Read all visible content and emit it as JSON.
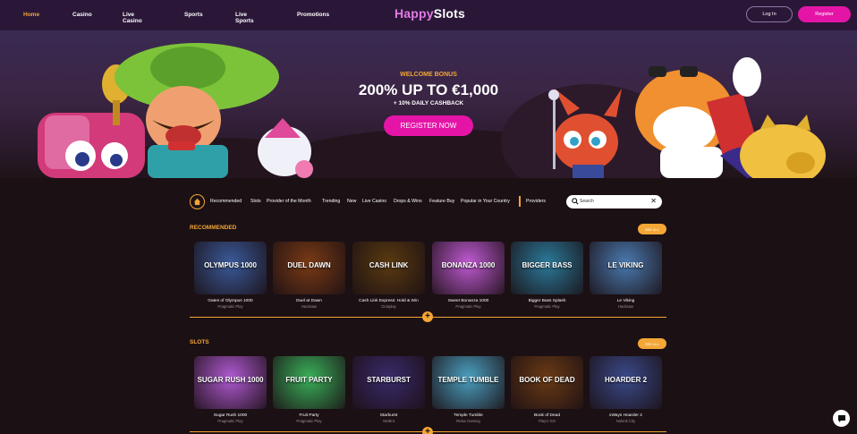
{
  "nav": {
    "links": [
      "Home",
      "Casino",
      "Live Casino",
      "Sports",
      "Live Sports",
      "Promotions"
    ],
    "logo_part1": "Happy",
    "logo_part2": "Slots",
    "login_label": "Log In",
    "register_label": "Register"
  },
  "hero": {
    "bonus_label": "WELCOME BONUS",
    "title": "200% UP TO €1,000",
    "subtitle": "+ 10% DAILY CASHBACK",
    "cta_label": "REGISTER NOW"
  },
  "filters": {
    "items": [
      "Recommended",
      "Slots",
      "Provider of the Month",
      "Trending",
      "New",
      "Live Casino",
      "Drops & Wins",
      "Feature Buy",
      "Popular in Your Country",
      "Providers"
    ]
  },
  "search": {
    "placeholder": "Search"
  },
  "sections": [
    {
      "title": "RECOMMENDED",
      "see_all": "SEE ALL",
      "games": [
        {
          "name": "Gates of Olympus 1000",
          "provider": "Pragmatic Play",
          "art": "OLYMPUS 1000",
          "color": "#3a5a9a"
        },
        {
          "name": "Duel at Dawn",
          "provider": "Hacksaw",
          "art": "DUEL DAWN",
          "color": "#7a3a14"
        },
        {
          "name": "Cash Link Express: Hold & Win",
          "provider": "Octoplay",
          "art": "CASH LINK",
          "color": "#5a3a10"
        },
        {
          "name": "Sweet Bonanza 1000",
          "provider": "Pragmatic Play",
          "art": "BONANZA 1000",
          "color": "#c05ad2"
        },
        {
          "name": "Bigger Bass Splash",
          "provider": "Pragmatic Play",
          "art": "BIGGER BASS",
          "color": "#2a7a9a"
        },
        {
          "name": "Le Viking",
          "provider": "Hacksaw",
          "art": "LE VIKING",
          "color": "#4a7ab0"
        }
      ]
    },
    {
      "title": "SLOTS",
      "see_all": "SEE ALL",
      "games": [
        {
          "name": "Sugar Rush 1000",
          "provider": "Pragmatic Play",
          "art": "SUGAR RUSH 1000",
          "color": "#b05ad2"
        },
        {
          "name": "Fruit Party",
          "provider": "Pragmatic Play",
          "art": "FRUIT PARTY",
          "color": "#3ab05a"
        },
        {
          "name": "Starburst",
          "provider": "NetEnt",
          "art": "STARBURST",
          "color": "#3a2a6a"
        },
        {
          "name": "Temple Tumble",
          "provider": "Relax Gaming",
          "art": "TEMPLE TUMBLE",
          "color": "#4aa0c0"
        },
        {
          "name": "Book of Dead",
          "provider": "Play'n GO",
          "art": "BOOK OF DEAD",
          "color": "#6a3a14"
        },
        {
          "name": "xWays Hoarder 2",
          "provider": "Nolimit City",
          "art": "HOARDER 2",
          "color": "#3a4a8a"
        }
      ]
    }
  ],
  "colors": {
    "accent": "#f4a636",
    "brand_pink": "#e415a6",
    "background": "#1b1014"
  }
}
